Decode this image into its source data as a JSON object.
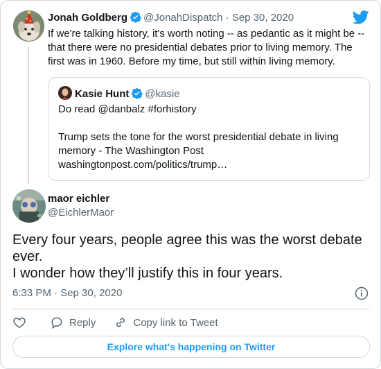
{
  "parent_tweet": {
    "author_name": "Jonah Goldberg",
    "author_handle": "@JonahDispatch",
    "separator": "·",
    "date": "Sep 30, 2020",
    "text": "If we're talking history, it's worth noting -- as pedantic as it might be -- that there were no presidential debates prior to living memory. The first was in 1960. Before my time, but still within living memory."
  },
  "quoted_tweet": {
    "author_name": "Kasie Hunt",
    "author_handle": "@kasie",
    "line1": "Do read @danbalz #forhistory",
    "line2": "Trump sets the tone for the worst presidential debate in living memory - The Washington Post",
    "line3": "washingtonpost.com/politics/trump…"
  },
  "main_tweet": {
    "author_name": "maor eichler",
    "author_handle": "@EichlerMaor",
    "text_line1": "Every four years, people agree this was the worst debate ever.",
    "text_line2": "I wonder how they’ll justify this in four years.",
    "timestamp": "6:33 PM · Sep 30, 2020"
  },
  "actions": {
    "reply_label": "Reply",
    "copy_label": "Copy link to Tweet"
  },
  "explore_label": "Explore what's happening on Twitter",
  "icons": {
    "brand": "twitter-bird-icon",
    "verified": "verified-badge-icon",
    "like": "heart-icon",
    "reply": "speech-bubble-icon",
    "copy": "link-icon",
    "info": "info-icon"
  },
  "colors": {
    "accent": "#1d9bf0",
    "text": "#0f1419",
    "muted": "#536471",
    "border": "#cfd9de"
  }
}
